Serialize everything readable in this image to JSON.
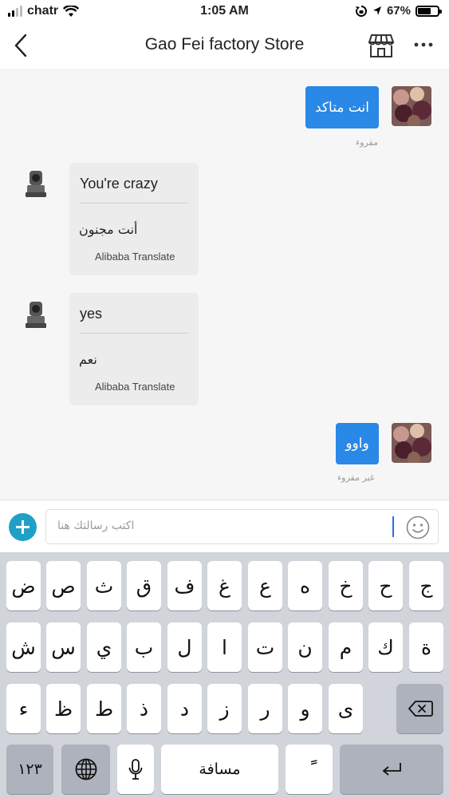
{
  "status_bar": {
    "carrier": "chatr",
    "time": "1:05 AM",
    "battery_text": "67%",
    "battery_level": 0.67
  },
  "nav": {
    "title": "Gao Fei factory Store",
    "back_icon": "chevron-left-icon",
    "store_icon": "store-icon",
    "more_icon": "more-icon"
  },
  "messages": [
    {
      "kind": "outgoing",
      "text": "انت متاكد",
      "status": "مقروء"
    },
    {
      "kind": "incoming",
      "original": "You're crazy",
      "translation": "أنت مجنون",
      "translator": "Alibaba Translate"
    },
    {
      "kind": "incoming",
      "original": "yes",
      "translation": "نعم",
      "translator": "Alibaba Translate"
    },
    {
      "kind": "outgoing",
      "text": "واوو",
      "status": "غير مقروء"
    }
  ],
  "input": {
    "placeholder": "اكتب رسالتك هنا"
  },
  "keyboard": {
    "row1": [
      "ض",
      "ص",
      "ث",
      "ق",
      "ف",
      "غ",
      "ع",
      "ه",
      "خ",
      "ح",
      "ج"
    ],
    "row2": [
      "ش",
      "س",
      "ي",
      "ب",
      "ل",
      "ا",
      "ت",
      "ن",
      "م",
      "ك",
      "ة"
    ],
    "row3": [
      "ء",
      "ظ",
      "ط",
      "ذ",
      "د",
      "ز",
      "ر",
      "و",
      "ى"
    ],
    "numbers_label": "١٢٣",
    "space_label": "مسافة",
    "diacritic_label": "ًً"
  },
  "colors": {
    "accent_blue": "#2a88e6",
    "add_button": "#1fa0c7",
    "chat_bg": "#f6f6f6",
    "keyboard_bg": "#d1d4db"
  }
}
